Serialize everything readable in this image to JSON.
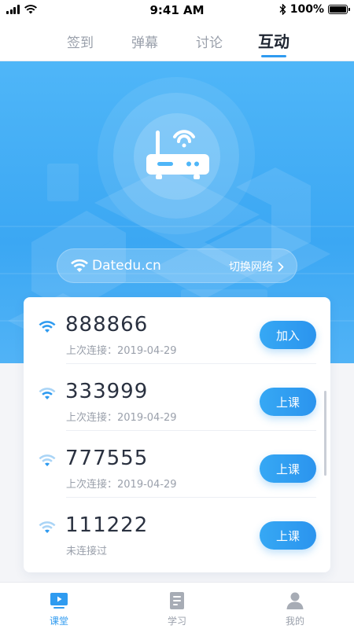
{
  "status_bar": {
    "time": "9:41 AM",
    "battery": "100%"
  },
  "tabs": [
    {
      "label": "签到"
    },
    {
      "label": "弹幕"
    },
    {
      "label": "讨论"
    },
    {
      "label": "互动",
      "active": true
    }
  ],
  "network": {
    "name": "Datedu.cn",
    "switch_label": "切换网络",
    "switch_icon": "chevron-right-icon"
  },
  "classrooms": [
    {
      "code": "888866",
      "status": "上次连接：2019-04-29",
      "action": "加入"
    },
    {
      "code": "333999",
      "status": "上次连接：2019-04-29",
      "action": "上课"
    },
    {
      "code": "777555",
      "status": "上次连接：2019-04-29",
      "action": "上课"
    },
    {
      "code": "111222",
      "status": "未连接过",
      "action": "上课"
    }
  ],
  "bottom_nav": [
    {
      "label": "课堂",
      "icon": "classroom-video-icon",
      "active": true
    },
    {
      "label": "学习",
      "icon": "study-book-icon"
    },
    {
      "label": "我的",
      "icon": "profile-person-icon"
    }
  ],
  "colors": {
    "accent": "#2f9bf0",
    "hero_top": "#4fb6f8",
    "hero_bottom": "#51b3f6"
  }
}
